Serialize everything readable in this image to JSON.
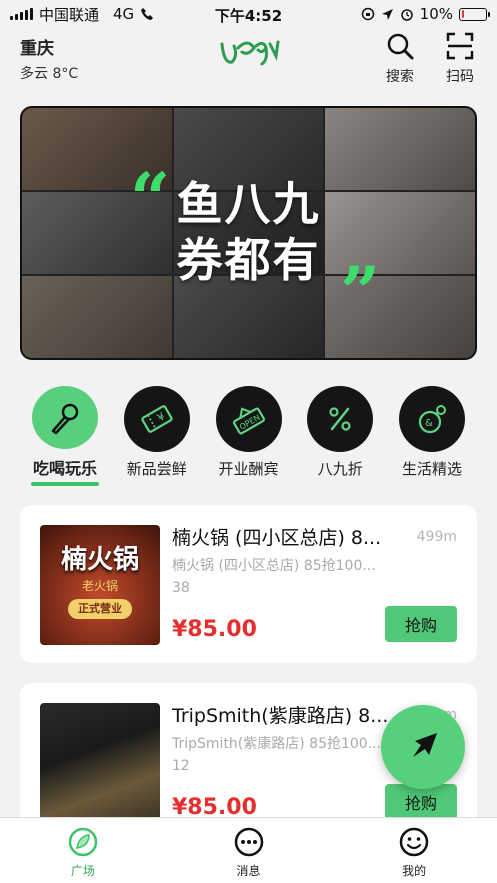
{
  "status_bar": {
    "carrier": "中国联通",
    "network": "4G",
    "time": "下午4:52",
    "battery": "10%",
    "battery_level": 0.1
  },
  "header": {
    "city": "重庆",
    "weather": "多云 8°C",
    "search_label": "搜索",
    "scan_label": "扫码"
  },
  "banner": {
    "line1": "鱼八九",
    "line2": "券都有",
    "open_quote": "“",
    "close_quote": "”"
  },
  "categories": [
    {
      "label": "吃喝玩乐",
      "icon": "microphone-icon",
      "active": true
    },
    {
      "label": "新品尝鲜",
      "icon": "ticket-icon",
      "active": false
    },
    {
      "label": "开业酬宾",
      "icon": "open-sign-icon",
      "active": false
    },
    {
      "label": "八九折",
      "icon": "percent-icon",
      "active": false
    },
    {
      "label": "生活精选",
      "icon": "bag-icon",
      "active": false
    }
  ],
  "deals": [
    {
      "title": "楠火锅 (四小区总店) 8...",
      "distance": "499m",
      "subtitle_line1": "楠火锅 (四小区总店) 85抢100...",
      "subtitle_line2": "38",
      "price": "¥85.00",
      "buy_label": "抢购",
      "image_title": "楠火锅",
      "image_subtitle": "老火锅",
      "image_badge": "正式营业"
    },
    {
      "title": "TripSmith(紫康路店) 8...",
      "distance": "499m",
      "subtitle_line1": "TripSmith(紫康路店) 85抢100...",
      "subtitle_line2": "12",
      "price": "¥85.00",
      "buy_label": "抢购"
    }
  ],
  "tabbar": {
    "tabs": [
      {
        "label": "广场",
        "active": true
      },
      {
        "label": "消息",
        "active": false
      },
      {
        "label": "我的",
        "active": false
      }
    ]
  },
  "colors": {
    "accent_green": "#4fc977",
    "price_red": "#e52e2e"
  }
}
